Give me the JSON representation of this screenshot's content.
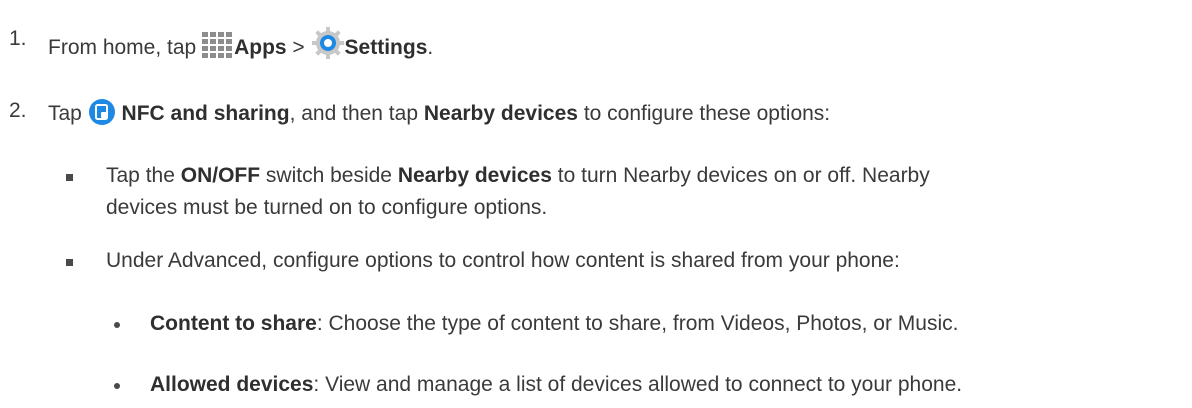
{
  "step1": {
    "number": "1.",
    "prefix": "From home, tap",
    "apps_label": "Apps",
    "separator": ">",
    "settings_label": "Settings",
    "suffix": ".",
    "apps_icon": "apps-grid-icon",
    "settings_icon": "settings-gear-icon"
  },
  "step2": {
    "number": "2.",
    "prefix": "Tap",
    "nfc_label": "NFC and sharing",
    "middle": ", and then tap",
    "nearby_label": "Nearby devices",
    "suffix": "to configure these options:",
    "nfc_icon": "nfc-sharing-icon",
    "nfc_icon_color": "#1e88e5"
  },
  "bullet1": {
    "t1": "Tap the",
    "onoff": "ON/OFF",
    "t2": "switch beside",
    "nearby": "Nearby devices",
    "t3": "to turn Nearby devices on or off. Nearby",
    "line2": "devices must be turned on to configure options."
  },
  "bullet2": {
    "text": "Under Advanced, configure options to control how content is shared from your phone:"
  },
  "sub1": {
    "label": "Content to share",
    "text": ": Choose the type of content to share, from Videos, Photos, or Music."
  },
  "sub2": {
    "label": "Allowed devices",
    "text": ": View and manage a list of devices allowed to connect to your phone."
  }
}
